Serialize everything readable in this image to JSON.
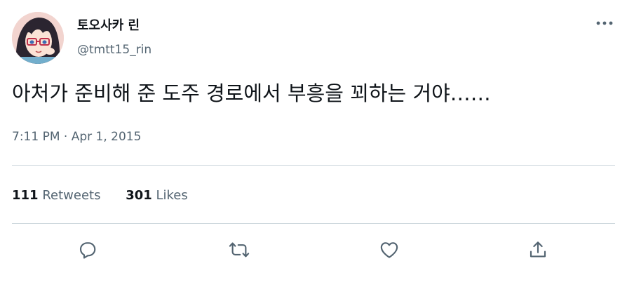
{
  "author": {
    "display_name": "토오사카 린",
    "handle": "@tmtt15_rin",
    "avatar_icon": "anime-girl-avatar-icon"
  },
  "tweet": {
    "text": "아처가 준비해 준 도주 경로에서 부흥을 꾀하는 거야……",
    "time": "7:11 PM",
    "separator": "·",
    "date": "Apr 1, 2015"
  },
  "stats": {
    "retweets_count": "111",
    "retweets_label": "Retweets",
    "likes_count": "301",
    "likes_label": "Likes"
  },
  "actions": {
    "icons": [
      "reply-icon",
      "retweet-icon",
      "like-icon",
      "share-icon"
    ]
  },
  "colors": {
    "text_primary": "#0f1419",
    "text_secondary": "#536471",
    "divider": "#cfd9de",
    "background": "#ffffff"
  }
}
